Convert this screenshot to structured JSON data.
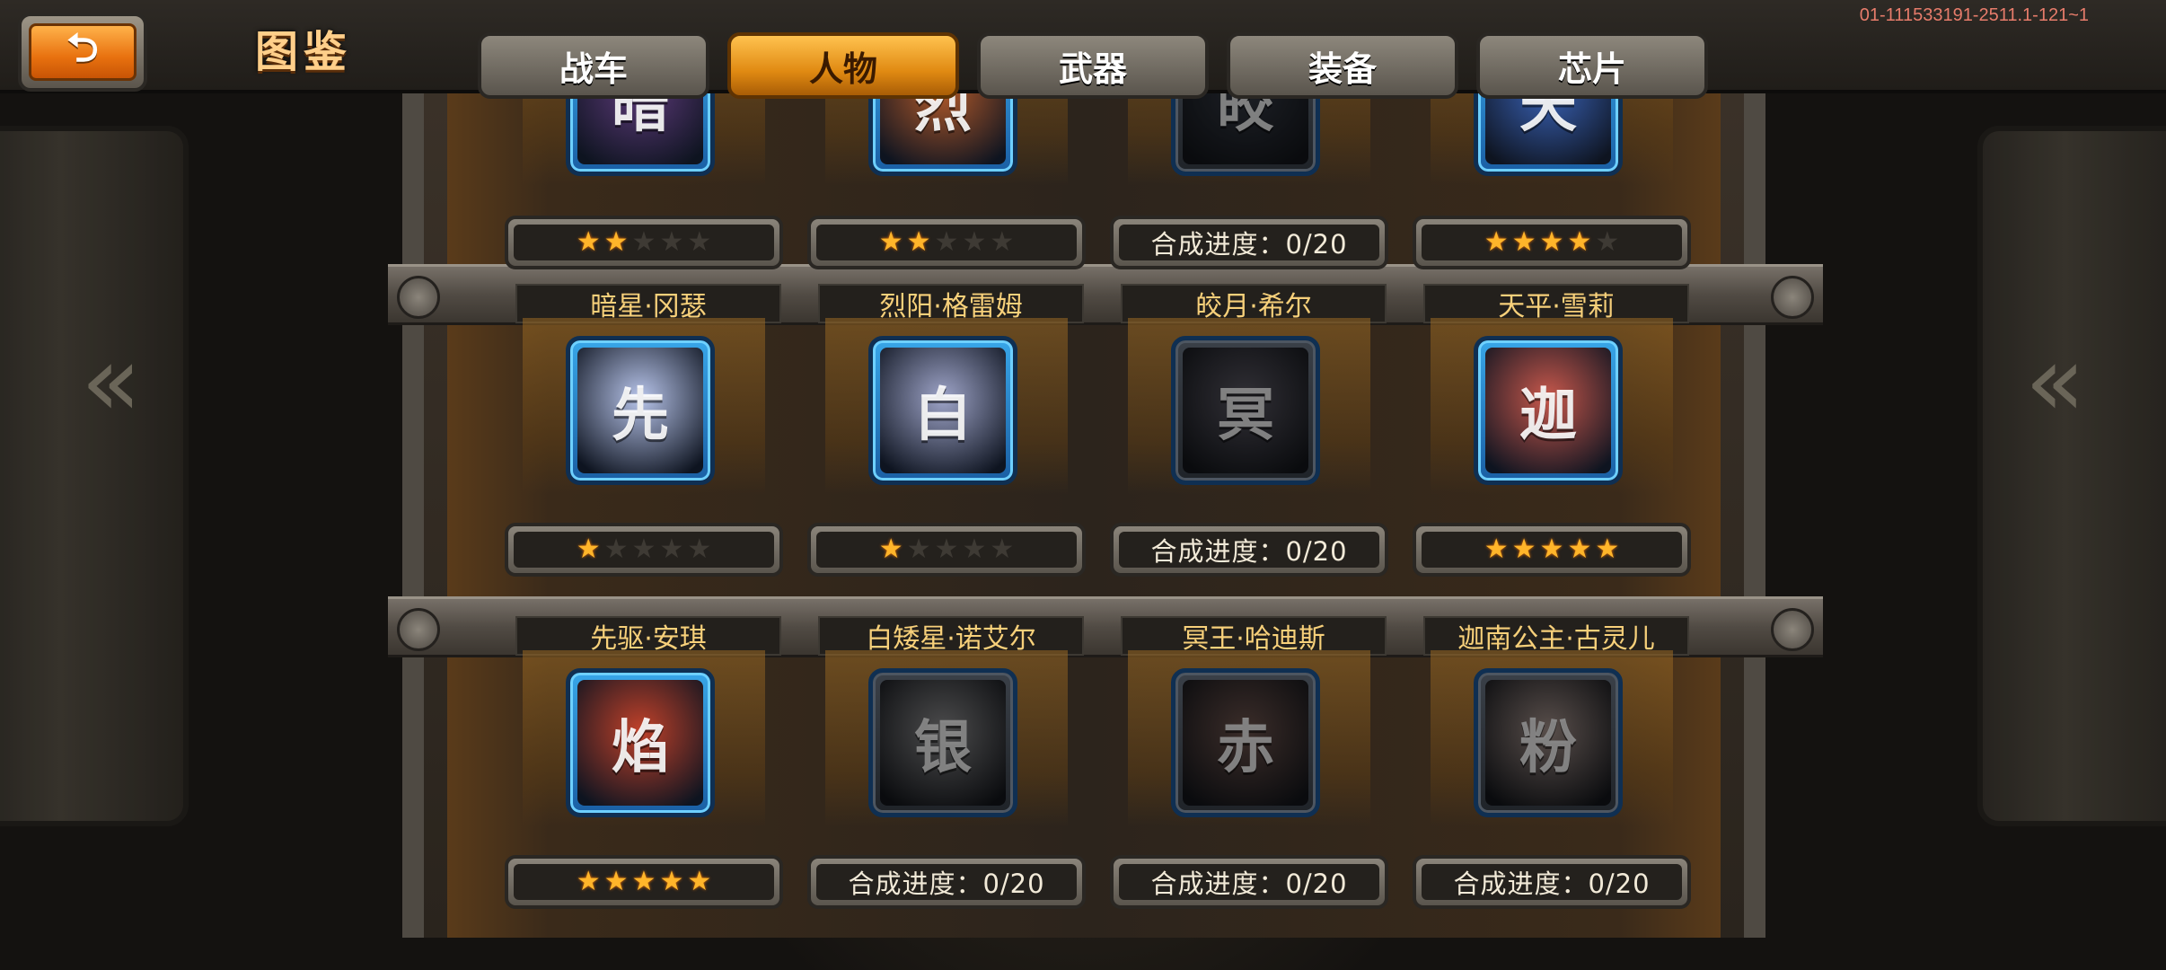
{
  "header": {
    "back_icon": "back-arrow-icon",
    "back_glyph": "⮌",
    "title": "图鉴",
    "version": "01-111533191-2511.1-121~1"
  },
  "tabs": [
    {
      "label": "战车",
      "active": false
    },
    {
      "label": "人物",
      "active": true
    },
    {
      "label": "武器",
      "active": false
    },
    {
      "label": "装备",
      "active": false
    },
    {
      "label": "芯片",
      "active": false
    }
  ],
  "colors": {
    "accent": "#e8710f",
    "star_on": "#ffb52a",
    "name_text": "#f7d07a",
    "frame_blue": "#38a6e8"
  },
  "rows": [
    {
      "cards": [
        {
          "name": "暗星·冈瑟",
          "stars": 2,
          "progress": null,
          "locked": false,
          "color": "#5d3a7a",
          "glyph": "暗"
        },
        {
          "name": "烈阳·格雷姆",
          "stars": 2,
          "progress": null,
          "locked": false,
          "color": "#b35a2a",
          "glyph": "烈"
        },
        {
          "name": "皎月·希尔",
          "stars": null,
          "progress": "合成进度：0/20",
          "locked": true,
          "color": "#2d3b55",
          "glyph": "皎"
        },
        {
          "name": "天平·雪莉",
          "stars": 4,
          "progress": null,
          "locked": false,
          "color": "#3a63b8",
          "glyph": "天"
        }
      ]
    },
    {
      "cards": [
        {
          "name": "先驱·安琪",
          "stars": 1,
          "progress": null,
          "locked": false,
          "color": "#b7c4ea",
          "glyph": "先"
        },
        {
          "name": "白矮星·诺艾尔",
          "stars": 1,
          "progress": null,
          "locked": false,
          "color": "#9ea4c8",
          "glyph": "白"
        },
        {
          "name": "冥王·哈迪斯",
          "stars": null,
          "progress": "合成进度：0/20",
          "locked": true,
          "color": "#5a5470",
          "glyph": "冥"
        },
        {
          "name": "迦南公主·古灵儿",
          "stars": 5,
          "progress": null,
          "locked": false,
          "color": "#c8584c",
          "glyph": "迦"
        }
      ]
    },
    {
      "cards": [
        {
          "name": "",
          "stars": 5,
          "progress": null,
          "locked": false,
          "color": "#c0412a",
          "glyph": "焰"
        },
        {
          "name": "",
          "stars": null,
          "progress": "合成进度：0/20",
          "locked": true,
          "color": "#8a8a8e",
          "glyph": "银"
        },
        {
          "name": "",
          "stars": null,
          "progress": "合成进度：0/20",
          "locked": true,
          "color": "#8a4a3a",
          "glyph": "赤"
        },
        {
          "name": "",
          "stars": null,
          "progress": "合成进度：0/20",
          "locked": true,
          "color": "#b88a7a",
          "glyph": "粉"
        }
      ]
    }
  ]
}
